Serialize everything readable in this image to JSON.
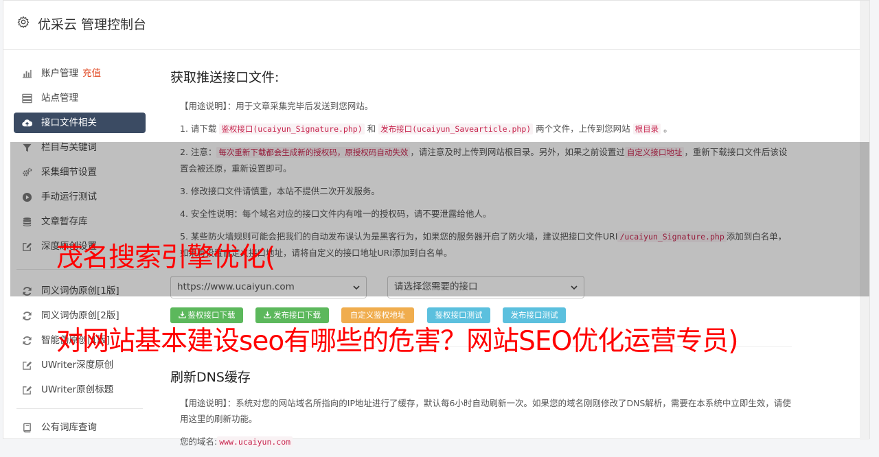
{
  "header": {
    "title": "优采云 管理控制台"
  },
  "sidebar": {
    "items": [
      {
        "label": "账户管理",
        "badge": "充值",
        "icon": "bar-chart-icon"
      },
      {
        "label": "站点管理",
        "icon": "server-icon"
      },
      {
        "label": "接口文件相关",
        "icon": "cloud-upload-icon",
        "active": true
      },
      {
        "label": "栏目与关键词",
        "icon": "filter-icon"
      },
      {
        "label": "采集细节设置",
        "icon": "gears-icon"
      },
      {
        "label": "手动运行测试",
        "icon": "play-circle-icon"
      },
      {
        "label": "文章暂存库",
        "icon": "database-icon"
      },
      {
        "label": "深度原创设置",
        "icon": "edit-icon"
      },
      {
        "label": "同义词伪原创[1版]",
        "icon": "refresh-icon"
      },
      {
        "label": "同义词伪原创[2版]",
        "icon": "refresh-icon"
      },
      {
        "label": "智能伪原创[1版]",
        "icon": "refresh-icon"
      },
      {
        "label": "UWriter深度原创",
        "icon": "edit-icon"
      },
      {
        "label": "UWriter原创标题",
        "icon": "edit-icon"
      },
      {
        "label": "公有词库查询",
        "icon": "book-icon"
      }
    ]
  },
  "push": {
    "title": "获取推送接口文件:",
    "usage_label": "【用途说明】",
    "usage_text": "：用于文章采集完毕后发送到您网站。",
    "s1_a": "1. 请下载 ",
    "s1_code1": "鉴权接口(ucaiyun_Signature.php)",
    "s1_b": " 和 ",
    "s1_code2": "发布接口(ucaiyun_Savearticle.php)",
    "s1_c": " 两个文件，上传到您网站 ",
    "s1_code3": "根目录",
    "s1_d": " 。",
    "s2_a": "2. 注意：",
    "s2_code1": "每次重新下载都会生成新的授权码，原授权码自动失效",
    "s2_b": "，请注意及时上传到网站根目录。另外，如果之前设置过",
    "s2_code2": "自定义接口地址",
    "s2_c": "，重新下载接口文件后该设置会被还原，重新设置即可。",
    "s3": "3. 修改接口文件请慎重，本站不提供二次开发服务。",
    "s4": "4. 安全性说明：每个域名对应的接口文件内有唯一的授权码，请不要泄露给他人。",
    "s5_a": "5. 某些防火墙规则可能会把我们的自动发布误认为是黑客行为，如果您的服务器开启了防火墙，建议把接口文件URI",
    "s5_code": "/ucaiyun_Signature.php",
    "s5_b": "添加到白名单，如果有设置自定义接口地址，请将自定义的接口地址URI添加到白名单。",
    "select_site": "https://www.ucaiyun.com",
    "select_iface": "请选择您需要的接口",
    "btn_auth_download": "鉴权接口下载",
    "btn_pub_download": "发布接口下载",
    "btn_custom": "自定义鉴权地址",
    "btn_auth_test": "鉴权接口测试",
    "btn_pub_test": "发布接口测试"
  },
  "dns": {
    "title": "刷新DNS缓存",
    "usage_label": "【用途说明】",
    "usage_text": "：系统对您的网站域名所指向的IP地址进行了缓存，默认每6小时自动刷新一次。如果您的域名刚刚修改了DNS解析，需要在本系统中立即生效，请使用这里的刷新功能。",
    "domain_label": "您的域名:",
    "domain_value": "www.ucaiyun.com"
  },
  "watermark": {
    "line1": "茂名搜索引擎优化(",
    "line2": "对网站基本建设seo有哪些的危害？网站SEO优化运营专员)"
  },
  "colors": {
    "sidebar_active": "#3b4b63",
    "badge": "#e24b26",
    "code": "#c7254e",
    "btn_green": "#5cb85c",
    "btn_orange": "#f0ad4e",
    "btn_blue": "#5bc0de",
    "watermark": "#ff0000"
  }
}
